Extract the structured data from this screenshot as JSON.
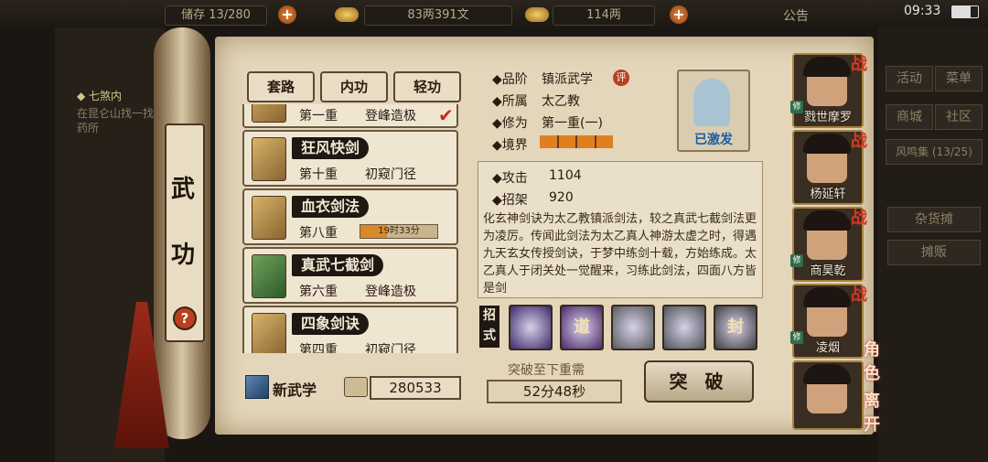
{
  "top_bar": {
    "inventory": "储存 13/280",
    "silver": "83两391文",
    "gold": "114两",
    "announcement": "公告",
    "clock": "09:33"
  },
  "background": {
    "quest_title": "◆ 七煞内",
    "quest_text": "在昆仑山找一找药所",
    "right_buttons": [
      "活动",
      "菜单",
      "商城",
      "社区",
      "风鸣集 (13/25)",
      "杂货摊",
      "摊贩"
    ]
  },
  "panel": {
    "title_chars": [
      "武",
      "功"
    ],
    "help_icon": "?",
    "tabs": [
      "套路",
      "内功",
      "轻功"
    ]
  },
  "skills": [
    {
      "name": "",
      "level": "第一重",
      "stage": "登峰造极",
      "checked": true,
      "book": "tan"
    },
    {
      "name": "狂风快剑",
      "level": "第十重",
      "stage": "初窥门径",
      "book": "tan"
    },
    {
      "name": "血衣剑法",
      "level": "第八重",
      "timer": "19时33分",
      "timer_progress": 0.35,
      "book": "tan"
    },
    {
      "name": "真武七截剑",
      "level": "第六重",
      "stage": "登峰造极",
      "book": "green"
    },
    {
      "name": "四象剑诀",
      "level": "第四重",
      "stage": "初窥门径",
      "book": "tan"
    }
  ],
  "bottom_left": {
    "new_skill_label": "新武学",
    "points": "280533"
  },
  "detail": {
    "grade_label": "◆品阶",
    "grade_value": "镇派武学",
    "grade_badge": "评",
    "faction_label": "◆所属",
    "faction_value": "太乙教",
    "cultivation_label": "◆修为",
    "cultivation_value": "第一重(一)",
    "realm_label": "◆境界",
    "realm_level": 3,
    "status": "已激发",
    "attack_label": "◆攻击",
    "attack_value": "1104",
    "parry_label": "◆招架",
    "parry_value": "920",
    "description": "化玄神剑诀为太乙教镇派剑法，较之真武七截剑法更为凌厉。传闻此剑法为太乙真人神游太虚之时，得遇九天玄女传授剑诀，于梦中练剑十载，方始练成。太乙真人于闭关处一觉醒来，习练此剑法，四面八方皆是剑"
  },
  "moves": {
    "label": "招式",
    "items": [
      {
        "icon": "purple-slash-icon",
        "glyph": "",
        "color": "#3b2b6b"
      },
      {
        "icon": "dao-seal-icon",
        "glyph": "道",
        "color": "#4a2a6a"
      },
      {
        "icon": "wind-slash-icon",
        "glyph": "",
        "color": "#555b60"
      },
      {
        "icon": "sword-rain-icon",
        "glyph": "",
        "color": "#4d5358"
      },
      {
        "icon": "seal-icon",
        "glyph": "封",
        "color": "#3c3f42"
      }
    ]
  },
  "breakthrough": {
    "requirement_label": "突破至下重需",
    "time": "52分48秒",
    "button": "突 破"
  },
  "characters": [
    {
      "name": "戮世摩罗",
      "battle": "战",
      "mark": "修"
    },
    {
      "name": "杨延轩",
      "battle": "战",
      "mark": ""
    },
    {
      "name": "商昊乾",
      "battle": "战",
      "mark": "修"
    },
    {
      "name": "凌烟",
      "battle": "战",
      "mark": "修"
    },
    {
      "name": "",
      "battle": "",
      "mark": ""
    }
  ],
  "side_actions": {
    "role": "角色",
    "leave": "离开"
  }
}
